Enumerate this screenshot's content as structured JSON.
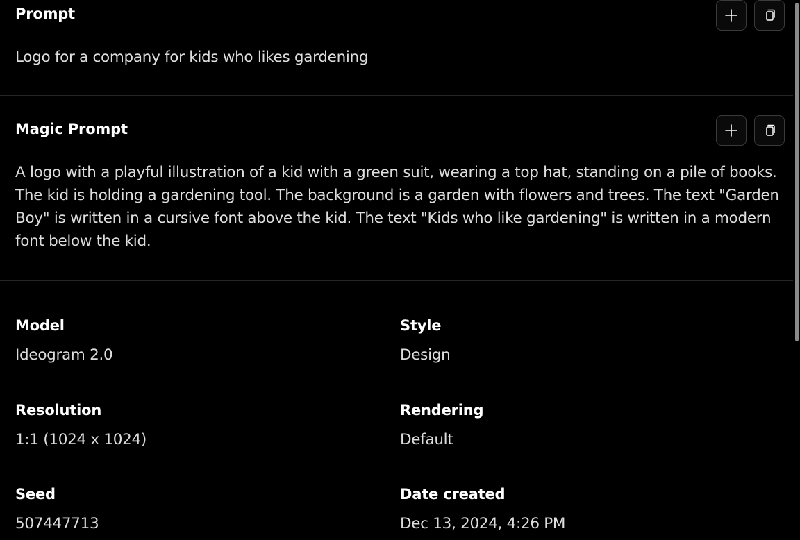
{
  "prompt": {
    "title": "Prompt",
    "text": "Logo for a company for kids who likes gardening"
  },
  "magic_prompt": {
    "title": "Magic Prompt",
    "text": "A logo with a playful illustration of a kid with a green suit, wearing a top hat, standing on a pile of books. The kid is holding a gardening tool. The background is a garden with flowers and trees. The text \"Garden Boy\" is written in a cursive font above the kid. The text \"Kids who like gardening\" is written in a modern font below the kid."
  },
  "details": {
    "model": {
      "label": "Model",
      "value": "Ideogram 2.0"
    },
    "style": {
      "label": "Style",
      "value": "Design"
    },
    "resolution": {
      "label": "Resolution",
      "value": "1:1 (1024 x 1024)"
    },
    "rendering": {
      "label": "Rendering",
      "value": "Default"
    },
    "seed": {
      "label": "Seed",
      "value": "507447713"
    },
    "date_created": {
      "label": "Date created",
      "value": "Dec 13, 2024, 4:26 PM"
    }
  },
  "icons": {
    "add": "plus-icon",
    "copy": "copy-icon"
  },
  "colors": {
    "background": "#000000",
    "divider": "#262626",
    "button_border": "#3a3a3a",
    "text_primary": "#ffffff",
    "text_secondary": "#dddddd"
  }
}
